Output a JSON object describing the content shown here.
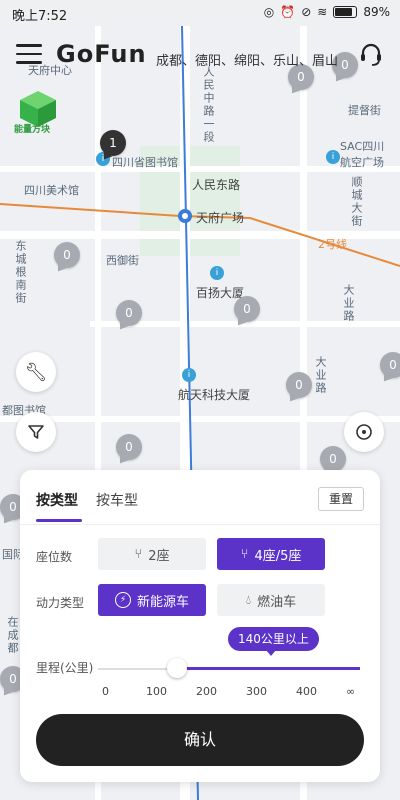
{
  "status_bar": {
    "time": "晚上7:52",
    "battery": "89%"
  },
  "header": {
    "logo": "GoFun",
    "cities": "成都、德阳、绵阳、乐山、眉山",
    "energy_label": "能量方块"
  },
  "map": {
    "labels": [
      "天府中心",
      "四川省图书馆",
      "四川美术馆",
      "人民东路",
      "天府广场",
      "西御街",
      "百扬大厦",
      "航天科技大厦",
      "都图书馆",
      "国际",
      "提督街",
      "SAC四川航空广场",
      "2号线"
    ],
    "vertical_labels": [
      "人民中路一段",
      "顺城大街",
      "东城根南街",
      "大业路",
      "大业路",
      "在成都"
    ],
    "pins": [
      "0",
      "1",
      "0",
      "0",
      "0",
      "0",
      "0",
      "0",
      "0",
      "0",
      "0",
      "0"
    ]
  },
  "filter_panel": {
    "tabs": [
      "按类型",
      "按车型"
    ],
    "reset_label": "重置",
    "seat_label": "座位数",
    "seat_options": [
      {
        "label": "2座",
        "selected": false
      },
      {
        "label": "4座/5座",
        "selected": true
      }
    ],
    "power_label": "动力类型",
    "power_options": [
      {
        "label": "新能源车",
        "selected": true
      },
      {
        "label": "燃油车",
        "selected": false
      }
    ],
    "range_label": "里程(公里)",
    "range_bubble": "140公里以上",
    "range_ticks": [
      "0",
      "100",
      "200",
      "300",
      "400",
      "∞"
    ],
    "range_value_km": 140,
    "confirm_label": "确认"
  },
  "colors": {
    "accent": "#5b33c9",
    "confirm": "#222222",
    "metro_line_1": "#3b7dd8",
    "metro_line_2": "#e8893a"
  }
}
